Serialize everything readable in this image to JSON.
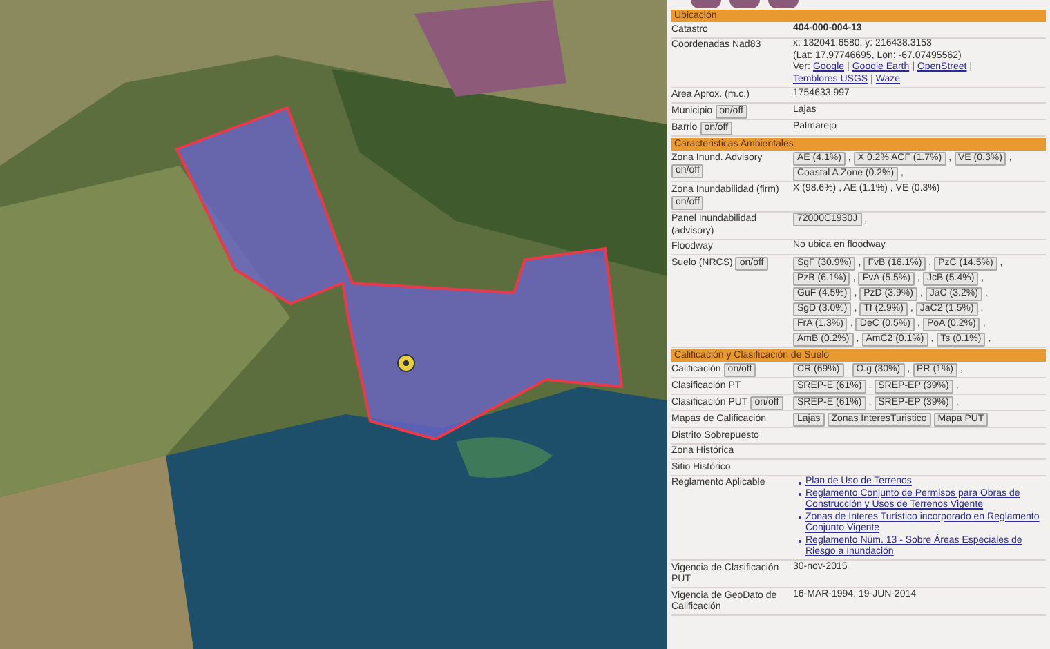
{
  "sections": [
    {
      "title": "Ubicación",
      "rows": [
        {
          "kind": "text",
          "label": "Catastro",
          "value": "404-000-004-13",
          "bold": true
        },
        {
          "kind": "coords",
          "label": "Coordenadas Nad83",
          "lines": [
            "x: 132041.6580, y: 216438.3153",
            "(Lat: 17.97746695, Lon: -67.07495562)"
          ],
          "links_label": "Ver:",
          "separator": "|",
          "links": [
            "Google",
            "Google Earth",
            "OpenStreet",
            "Temblores USGS",
            "Waze"
          ]
        },
        {
          "kind": "text",
          "label": "Area Aprox. (m.c.)",
          "value": "1754633.997"
        },
        {
          "kind": "text",
          "label": "Municipio",
          "toggle": "on/off",
          "value": "Lajas"
        },
        {
          "kind": "text",
          "label": "Barrio",
          "toggle": "on/off",
          "value": "Palmarejo"
        }
      ]
    },
    {
      "title": "Caracteristicas Ambientales",
      "rows": [
        {
          "kind": "chips",
          "label": "Zona Inund. Advisory",
          "toggle": "on/off",
          "toggle_below": true,
          "separator": ",",
          "chips": [
            [
              "AE (4.1%)",
              "X 0.2% ACF (1.7%)",
              "VE (0.3%)"
            ],
            [
              "Coastal A Zone (0.2%)"
            ]
          ]
        },
        {
          "kind": "text",
          "label": "Zona Inundabilidad (firm)",
          "toggle": "on/off",
          "toggle_below": true,
          "value": "X (98.6%) , AE (1.1%) , VE (0.3%)"
        },
        {
          "kind": "chips",
          "label": "Panel Inundabilidad (advisory)",
          "separator": ",",
          "chips": [
            [
              "72000C1930J"
            ]
          ]
        },
        {
          "kind": "text",
          "label": "Floodway",
          "value": "No ubica en floodway"
        },
        {
          "kind": "chips",
          "label": "Suelo (NRCS)",
          "toggle": "on/off",
          "separator": ",",
          "chips": [
            [
              "SgF (30.9%)",
              "FvB (16.1%)",
              "PzC (14.5%)"
            ],
            [
              "PzB (6.1%)",
              "FvA (5.5%)",
              "JcB (5.4%)"
            ],
            [
              "GuF (4.5%)",
              "PzD (3.9%)",
              "JaC (3.2%)"
            ],
            [
              "SgD (3.0%)",
              "Tf (2.9%)",
              "JaC2 (1.5%)"
            ],
            [
              "FrA (1.3%)",
              "DeC (0.5%)",
              "PoA (0.2%)"
            ],
            [
              "AmB (0.2%)",
              "AmC2 (0.1%)",
              "Ts (0.1%)"
            ]
          ]
        }
      ]
    },
    {
      "title": "Calificación y Clasificación de Suelo",
      "rows": [
        {
          "kind": "chips",
          "label": "Calificación",
          "toggle": "on/off",
          "separator": ",",
          "chips": [
            [
              "CR (69%)",
              "O.g (30%)",
              "PR (1%)"
            ]
          ]
        },
        {
          "kind": "chips",
          "label": "Clasificación PT",
          "separator": ",",
          "chips": [
            [
              "SREP-E (61%)",
              "SREP-EP (39%)"
            ]
          ]
        },
        {
          "kind": "chips",
          "label": "Clasificación PUT",
          "toggle": "on/off",
          "separator": ",",
          "chips": [
            [
              "SREP-E (61%)",
              "SREP-EP (39%)"
            ]
          ]
        },
        {
          "kind": "buttons",
          "label": "Mapas de Calificación",
          "buttons": [
            "Lajas",
            "Zonas InteresTuristico",
            "Mapa PUT"
          ]
        },
        {
          "kind": "text",
          "label": "Distrito Sobrepuesto"
        },
        {
          "kind": "text",
          "label": "Zona Histórica"
        },
        {
          "kind": "text",
          "label": "Sitio Histórico"
        },
        {
          "kind": "links",
          "label": "Reglamento Aplicable",
          "links": [
            "Plan de Uso de Terrenos",
            "Reglamento Conjunto de Permisos para Obras de Construcción y Usos de Terrenos Vigente",
            "Zonas de Interes Turístico incorporado en Reglamento Conjunto Vigente",
            "Reglamento Núm. 13 - Sobre Áreas Especiales de Riesgo a Inundación"
          ]
        },
        {
          "kind": "text",
          "label": "Vigencia de Clasificación PUT",
          "value": "30-nov-2015"
        },
        {
          "kind": "text",
          "label": "Vigencia de GeoDato de Calificación",
          "value": "16-MAR-1994, 19-JUN-2014"
        }
      ]
    }
  ]
}
